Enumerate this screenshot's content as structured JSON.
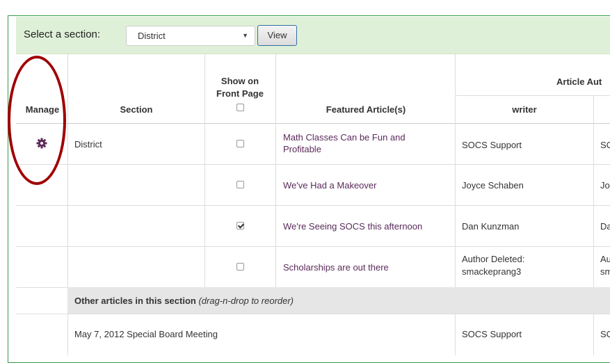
{
  "toolbar": {
    "select_label": "Select a section:",
    "selected_section": "District",
    "view_label": "View"
  },
  "table": {
    "headers": {
      "manage": "Manage",
      "section": "Section",
      "show_front_line1": "Show on",
      "show_front_line2": "Front Page",
      "featured": "Featured Article(s)",
      "author_group": "Article Aut",
      "writer": "writer"
    },
    "featured_rows": [
      {
        "section": "District",
        "show_front": false,
        "title_line1": "Math Classes Can be Fun and",
        "title_line2": "Profitable",
        "writer_line1": "SOCS Support",
        "writer_line2": "",
        "next_col_line1": "SC",
        "next_col_line2": ""
      },
      {
        "section": "",
        "show_front": false,
        "title_line1": "We've Had a Makeover",
        "title_line2": "",
        "writer_line1": "Joyce Schaben",
        "writer_line2": "",
        "next_col_line1": "Jo",
        "next_col_line2": ""
      },
      {
        "section": "",
        "show_front": true,
        "title_line1": "We're Seeing SOCS this afternoon",
        "title_line2": "",
        "writer_line1": "Dan Kunzman",
        "writer_line2": "",
        "next_col_line1": "Da",
        "next_col_line2": ""
      },
      {
        "section": "",
        "show_front": false,
        "title_line1": "Scholarships are out there",
        "title_line2": "",
        "writer_line1": "Author Deleted:",
        "writer_line2": "smackeprang3",
        "next_col_line1": "Au",
        "next_col_line2": "sm"
      }
    ],
    "other_articles": {
      "heading": "Other articles in this section",
      "hint": "(drag-n-drop to reorder)",
      "rows": [
        {
          "title": "May 7, 2012 Special Board Meeting",
          "writer": "SOCS Support",
          "next_col": "SC"
        }
      ]
    }
  },
  "colors": {
    "highlight_oval": "#a00000",
    "gear": "#5a2a5a",
    "topbar_bg": "#dff0d8"
  },
  "icons": {
    "manage": "gear-icon"
  }
}
